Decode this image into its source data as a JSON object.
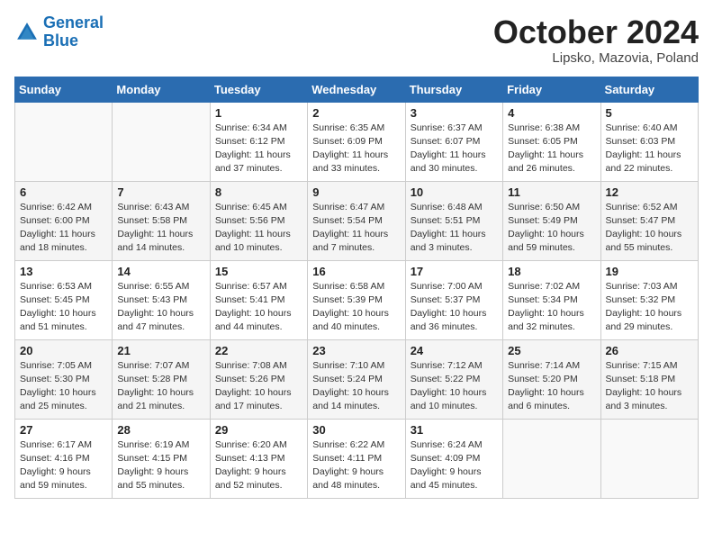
{
  "header": {
    "logo_line1": "General",
    "logo_line2": "Blue",
    "month_title": "October 2024",
    "subtitle": "Lipsko, Mazovia, Poland"
  },
  "days_of_week": [
    "Sunday",
    "Monday",
    "Tuesday",
    "Wednesday",
    "Thursday",
    "Friday",
    "Saturday"
  ],
  "weeks": [
    [
      {
        "day": "",
        "content": ""
      },
      {
        "day": "",
        "content": ""
      },
      {
        "day": "1",
        "content": "Sunrise: 6:34 AM\nSunset: 6:12 PM\nDaylight: 11 hours\nand 37 minutes."
      },
      {
        "day": "2",
        "content": "Sunrise: 6:35 AM\nSunset: 6:09 PM\nDaylight: 11 hours\nand 33 minutes."
      },
      {
        "day": "3",
        "content": "Sunrise: 6:37 AM\nSunset: 6:07 PM\nDaylight: 11 hours\nand 30 minutes."
      },
      {
        "day": "4",
        "content": "Sunrise: 6:38 AM\nSunset: 6:05 PM\nDaylight: 11 hours\nand 26 minutes."
      },
      {
        "day": "5",
        "content": "Sunrise: 6:40 AM\nSunset: 6:03 PM\nDaylight: 11 hours\nand 22 minutes."
      }
    ],
    [
      {
        "day": "6",
        "content": "Sunrise: 6:42 AM\nSunset: 6:00 PM\nDaylight: 11 hours\nand 18 minutes."
      },
      {
        "day": "7",
        "content": "Sunrise: 6:43 AM\nSunset: 5:58 PM\nDaylight: 11 hours\nand 14 minutes."
      },
      {
        "day": "8",
        "content": "Sunrise: 6:45 AM\nSunset: 5:56 PM\nDaylight: 11 hours\nand 10 minutes."
      },
      {
        "day": "9",
        "content": "Sunrise: 6:47 AM\nSunset: 5:54 PM\nDaylight: 11 hours\nand 7 minutes."
      },
      {
        "day": "10",
        "content": "Sunrise: 6:48 AM\nSunset: 5:51 PM\nDaylight: 11 hours\nand 3 minutes."
      },
      {
        "day": "11",
        "content": "Sunrise: 6:50 AM\nSunset: 5:49 PM\nDaylight: 10 hours\nand 59 minutes."
      },
      {
        "day": "12",
        "content": "Sunrise: 6:52 AM\nSunset: 5:47 PM\nDaylight: 10 hours\nand 55 minutes."
      }
    ],
    [
      {
        "day": "13",
        "content": "Sunrise: 6:53 AM\nSunset: 5:45 PM\nDaylight: 10 hours\nand 51 minutes."
      },
      {
        "day": "14",
        "content": "Sunrise: 6:55 AM\nSunset: 5:43 PM\nDaylight: 10 hours\nand 47 minutes."
      },
      {
        "day": "15",
        "content": "Sunrise: 6:57 AM\nSunset: 5:41 PM\nDaylight: 10 hours\nand 44 minutes."
      },
      {
        "day": "16",
        "content": "Sunrise: 6:58 AM\nSunset: 5:39 PM\nDaylight: 10 hours\nand 40 minutes."
      },
      {
        "day": "17",
        "content": "Sunrise: 7:00 AM\nSunset: 5:37 PM\nDaylight: 10 hours\nand 36 minutes."
      },
      {
        "day": "18",
        "content": "Sunrise: 7:02 AM\nSunset: 5:34 PM\nDaylight: 10 hours\nand 32 minutes."
      },
      {
        "day": "19",
        "content": "Sunrise: 7:03 AM\nSunset: 5:32 PM\nDaylight: 10 hours\nand 29 minutes."
      }
    ],
    [
      {
        "day": "20",
        "content": "Sunrise: 7:05 AM\nSunset: 5:30 PM\nDaylight: 10 hours\nand 25 minutes."
      },
      {
        "day": "21",
        "content": "Sunrise: 7:07 AM\nSunset: 5:28 PM\nDaylight: 10 hours\nand 21 minutes."
      },
      {
        "day": "22",
        "content": "Sunrise: 7:08 AM\nSunset: 5:26 PM\nDaylight: 10 hours\nand 17 minutes."
      },
      {
        "day": "23",
        "content": "Sunrise: 7:10 AM\nSunset: 5:24 PM\nDaylight: 10 hours\nand 14 minutes."
      },
      {
        "day": "24",
        "content": "Sunrise: 7:12 AM\nSunset: 5:22 PM\nDaylight: 10 hours\nand 10 minutes."
      },
      {
        "day": "25",
        "content": "Sunrise: 7:14 AM\nSunset: 5:20 PM\nDaylight: 10 hours\nand 6 minutes."
      },
      {
        "day": "26",
        "content": "Sunrise: 7:15 AM\nSunset: 5:18 PM\nDaylight: 10 hours\nand 3 minutes."
      }
    ],
    [
      {
        "day": "27",
        "content": "Sunrise: 6:17 AM\nSunset: 4:16 PM\nDaylight: 9 hours\nand 59 minutes."
      },
      {
        "day": "28",
        "content": "Sunrise: 6:19 AM\nSunset: 4:15 PM\nDaylight: 9 hours\nand 55 minutes."
      },
      {
        "day": "29",
        "content": "Sunrise: 6:20 AM\nSunset: 4:13 PM\nDaylight: 9 hours\nand 52 minutes."
      },
      {
        "day": "30",
        "content": "Sunrise: 6:22 AM\nSunset: 4:11 PM\nDaylight: 9 hours\nand 48 minutes."
      },
      {
        "day": "31",
        "content": "Sunrise: 6:24 AM\nSunset: 4:09 PM\nDaylight: 9 hours\nand 45 minutes."
      },
      {
        "day": "",
        "content": ""
      },
      {
        "day": "",
        "content": ""
      }
    ]
  ]
}
